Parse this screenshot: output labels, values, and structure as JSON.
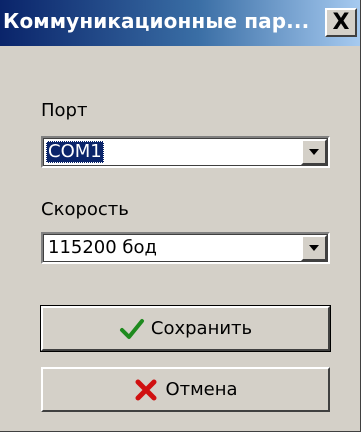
{
  "window": {
    "title": "Коммуникационные пар...",
    "close_label": "X"
  },
  "port": {
    "label": "Порт",
    "value": "COM1"
  },
  "speed": {
    "label": "Скорость",
    "value": "115200 бод"
  },
  "buttons": {
    "save_label": "Сохранить",
    "save_icon": "check-icon",
    "cancel_label": "Отмена",
    "cancel_icon": "x-icon"
  },
  "colors": {
    "title_bg": "#0a246a",
    "face": "#d4d0c8",
    "selection": "#0a246a",
    "check": "#1e8a1e",
    "cross": "#d01010"
  }
}
